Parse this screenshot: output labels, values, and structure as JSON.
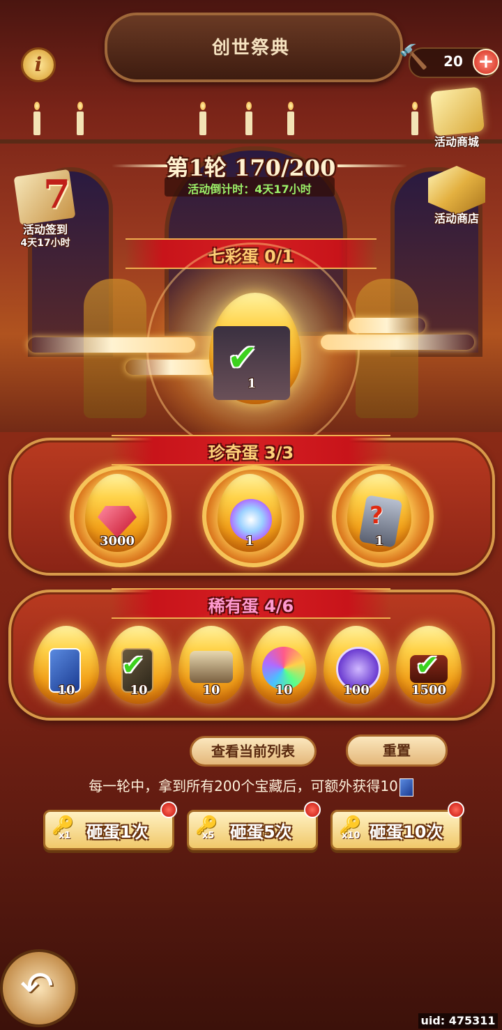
{
  "header": {
    "title": "创世祭典",
    "info_icon": "info-icon",
    "currency": {
      "icon": "hammer-icon",
      "value": "20",
      "add_icon": "plus-icon"
    }
  },
  "side_buttons": {
    "mall": {
      "label": "活动商城",
      "icon": "gift-box-icon"
    },
    "shop": {
      "label": "活动商店",
      "icon": "gold-ingot-icon"
    },
    "checkin": {
      "label": "活动签到",
      "day": "7",
      "countdown": "4天17小时",
      "icon": "calendar-icon"
    }
  },
  "round": {
    "title": "第1轮 170/200",
    "countdown": "活动倒计时：4天17小时"
  },
  "tiers": {
    "rainbow": {
      "label": "七彩蛋 0/1",
      "eggs": [
        {
          "prize": "hero-portrait",
          "qty": "1",
          "claimed": true
        }
      ]
    },
    "treasure": {
      "label": "珍奇蛋 3/3",
      "eggs": [
        {
          "prize": "ruby-gem-icon",
          "qty": "3000"
        },
        {
          "prize": "magic-orb-icon",
          "qty": "1"
        },
        {
          "prize": "mystery-box-icon",
          "qty": "1"
        }
      ]
    },
    "rare": {
      "label": "稀有蛋 4/6",
      "eggs": [
        {
          "prize": "blue-card-icon",
          "qty": "10",
          "claimed": false
        },
        {
          "prize": "dark-card-icon",
          "qty": "10",
          "claimed": true
        },
        {
          "prize": "treasure-chest-icon",
          "qty": "10",
          "claimed": false
        },
        {
          "prize": "rainbow-crystal-icon",
          "qty": "10",
          "claimed": false
        },
        {
          "prize": "purple-hammer-coin-icon",
          "qty": "100",
          "claimed": false
        },
        {
          "prize": "chest-icon",
          "qty": "1500",
          "claimed": true
        }
      ]
    }
  },
  "actions": {
    "view_list": "查看当前列表",
    "reset": "重置",
    "info": "每一轮中，拿到所有200个宝藏后，可额外获得10",
    "smash": [
      {
        "mult": "x1",
        "label": "砸蛋1次"
      },
      {
        "mult": "x5",
        "label": "砸蛋5次"
      },
      {
        "mult": "x10",
        "label": "砸蛋10次"
      }
    ]
  },
  "footer": {
    "uid": "uid: 475311",
    "back_icon": "back-arrow-icon"
  },
  "colors": {
    "accent_red": "#d41e22",
    "accent_gold": "#f6c45a",
    "countdown_green": "#9cf26a"
  }
}
